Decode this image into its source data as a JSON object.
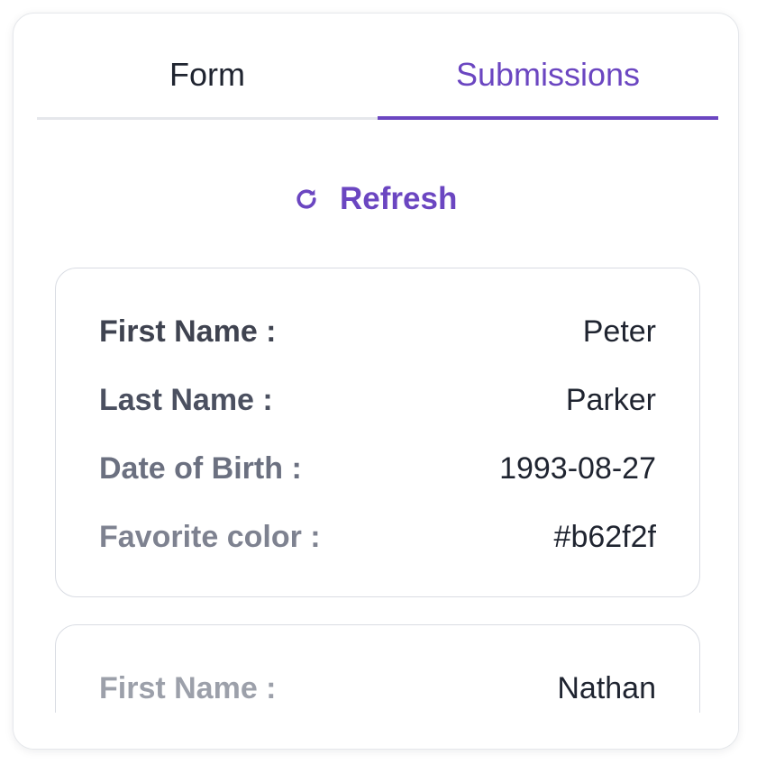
{
  "tabs": [
    {
      "label": "Form",
      "active": false
    },
    {
      "label": "Submissions",
      "active": true
    }
  ],
  "refresh": {
    "label": "Refresh",
    "icon": "refresh-icon"
  },
  "submissions": [
    {
      "first_name_label": "First Name :",
      "first_name": "Peter",
      "last_name_label": "Last Name :",
      "last_name": "Parker",
      "dob_label": "Date of Birth :",
      "dob": "1993-08-27",
      "color_label": "Favorite color :",
      "color": "#b62f2f"
    },
    {
      "first_name_label": "First Name :",
      "first_name": "Nathan"
    }
  ],
  "colors": {
    "accent": "#6b46c1",
    "text": "#1f2430",
    "border": "#e5e7eb"
  }
}
